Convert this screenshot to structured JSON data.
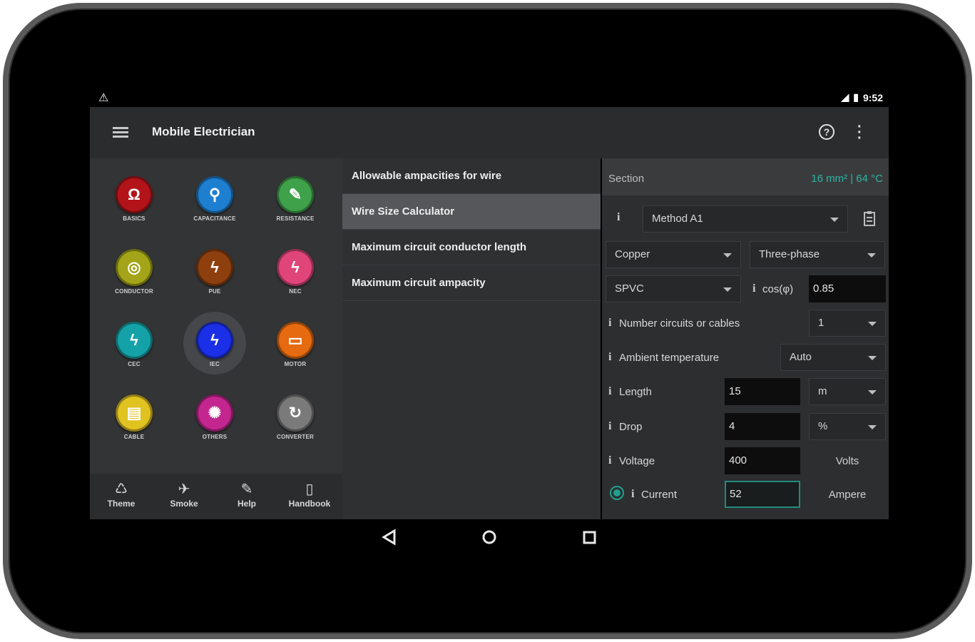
{
  "status": {
    "time": "9:52"
  },
  "appbar": {
    "title": "Mobile Electrician"
  },
  "tiles": [
    {
      "label": "BASICS",
      "glyph": "Ω",
      "color": "#b3141a",
      "icon": "omega-icon"
    },
    {
      "label": "CAPACITANCE",
      "glyph": "⚲",
      "color": "#1e7fd0",
      "icon": "capacitor-icon"
    },
    {
      "label": "RESISTANCE",
      "glyph": "✎",
      "color": "#3fa14a",
      "icon": "resistor-icon"
    },
    {
      "label": "CONDUCTOR",
      "glyph": "◎",
      "color": "#a4a418",
      "icon": "conductor-icon"
    },
    {
      "label": "PUE",
      "glyph": "ϟ",
      "color": "#8e3f0e",
      "icon": "bolt-icon"
    },
    {
      "label": "NEC",
      "glyph": "ϟ",
      "color": "#e0457a",
      "icon": "bolt-icon"
    },
    {
      "label": "CEC",
      "glyph": "ϟ",
      "color": "#15a1a8",
      "icon": "bolt-icon"
    },
    {
      "label": "IEC",
      "glyph": "ϟ",
      "color": "#1a2fe6",
      "icon": "bolt-icon"
    },
    {
      "label": "MOTOR",
      "glyph": "▭",
      "color": "#e56a10",
      "icon": "motor-icon"
    },
    {
      "label": "CABLE",
      "glyph": "▤",
      "color": "#e0c221",
      "icon": "cable-icon"
    },
    {
      "label": "OTHERS",
      "glyph": "✺",
      "color": "#c4268f",
      "icon": "others-icon"
    },
    {
      "label": "CONVERTER",
      "glyph": "↻",
      "color": "#7a7a7a",
      "icon": "converter-icon"
    }
  ],
  "bottom_nav": [
    {
      "label": "Theme",
      "glyph": "♺",
      "icon": "theme-icon"
    },
    {
      "label": "Smoke",
      "glyph": "✈",
      "icon": "smoke-icon"
    },
    {
      "label": "Help",
      "glyph": "✎",
      "icon": "help-edit-icon"
    },
    {
      "label": "Handbook",
      "glyph": "▯",
      "icon": "handbook-icon"
    }
  ],
  "menu_items": [
    "Allowable ampacities for wire",
    "Wire Size Calculator",
    "Maximum circuit conductor length",
    "Maximum circuit ampacity"
  ],
  "section": {
    "label": "Section",
    "result": "16 mm² | 64 °C"
  },
  "form": {
    "method": "Method A1",
    "material": "Copper",
    "phase": "Three-phase",
    "insulation": "SPVC",
    "cos_label": "cos(φ)",
    "cos_value": "0.85",
    "circuits_label": "Number circuits or cables",
    "circuits_value": "1",
    "ambient_label": "Ambient temperature",
    "ambient_value": "Auto",
    "length_label": "Length",
    "length_value": "15",
    "length_unit": "m",
    "drop_label": "Drop",
    "drop_value": "4",
    "drop_unit": "%",
    "voltage_label": "Voltage",
    "voltage_value": "400",
    "voltage_unit": "Volts",
    "current_label": "Current",
    "current_value": "52",
    "current_unit": "Ampere",
    "info_glyph": "i"
  }
}
